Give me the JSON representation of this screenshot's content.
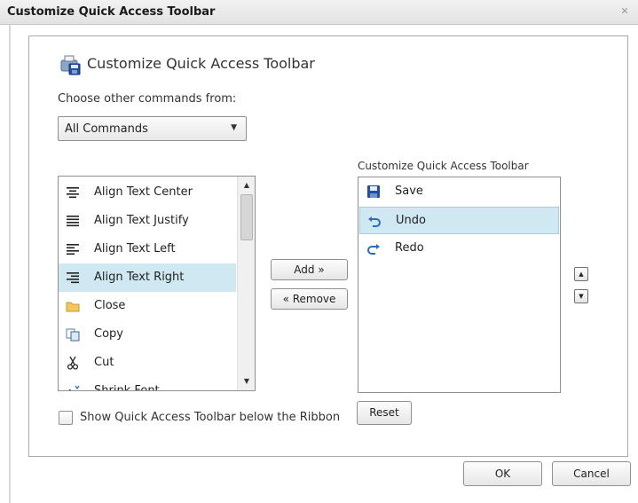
{
  "window": {
    "title": "Customize Quick Access Toolbar",
    "close_glyph": "✕"
  },
  "header": {
    "title": "Customize Quick Access Toolbar",
    "icon": "qat-customize-icon"
  },
  "source": {
    "label": "Choose other commands from:",
    "selected": "All Commands",
    "arrow": "▼"
  },
  "commands": [
    {
      "label": "Align Text Center",
      "icon": "align-center-icon",
      "selected": false
    },
    {
      "label": "Align Text Justify",
      "icon": "align-justify-icon",
      "selected": false
    },
    {
      "label": "Align Text Left",
      "icon": "align-left-icon",
      "selected": false
    },
    {
      "label": "Align Text Right",
      "icon": "align-right-icon",
      "selected": true
    },
    {
      "label": "Close",
      "icon": "folder-close-icon",
      "selected": false
    },
    {
      "label": "Copy",
      "icon": "copy-icon",
      "selected": false
    },
    {
      "label": "Cut",
      "icon": "scissors-icon",
      "selected": false
    },
    {
      "label": "Shrink Font",
      "icon": "shrink-font-icon",
      "selected": false
    }
  ],
  "toolbar_list": {
    "label": "Customize Quick Access Toolbar",
    "items": [
      {
        "label": "Save",
        "icon": "save-icon",
        "selected": false
      },
      {
        "label": "Undo",
        "icon": "undo-icon",
        "selected": true
      },
      {
        "label": "Redo",
        "icon": "redo-icon",
        "selected": false
      }
    ]
  },
  "buttons": {
    "add": "Add »",
    "remove": "« Remove",
    "reset": "Reset",
    "ok": "OK",
    "cancel": "Cancel",
    "move_up": "▲",
    "move_down": "▼"
  },
  "checkbox": {
    "label": "Show Quick Access Toolbar below the Ribbon",
    "checked": false
  },
  "colors": {
    "selection": "#cfe8f2",
    "accent": "#2a6ebb"
  }
}
